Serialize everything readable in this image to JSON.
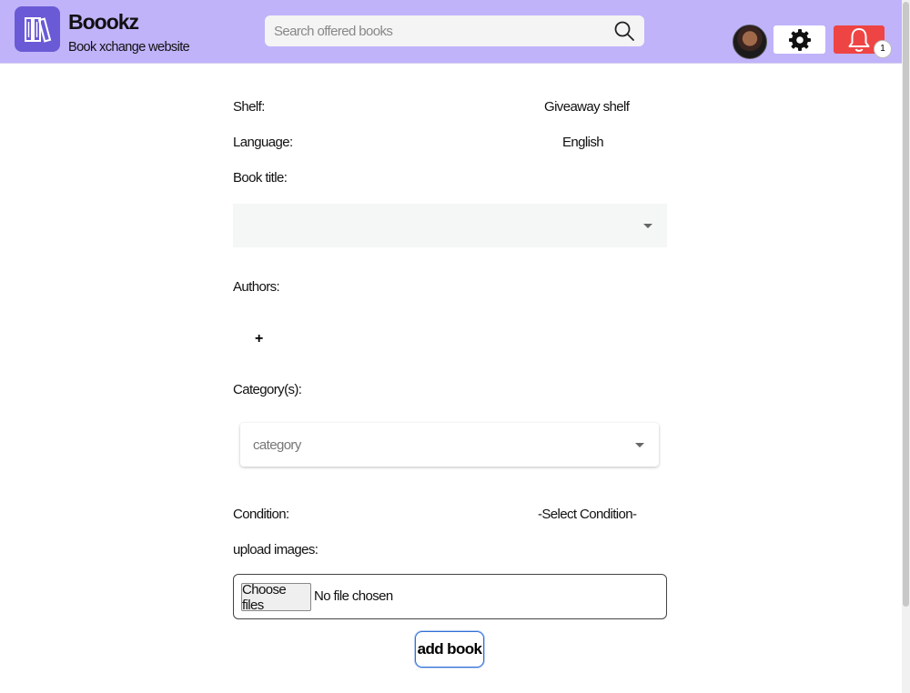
{
  "header": {
    "brand_title": "Boookz",
    "brand_subtitle": "Book xchange website",
    "search_placeholder": "Search offered books",
    "notification_count": "1",
    "icons": {
      "logo": "books-icon",
      "search": "search-icon",
      "settings": "gear-icon",
      "notifications": "bell-icon"
    }
  },
  "form": {
    "shelf_label": "Shelf:",
    "shelf_value": "Giveaway shelf",
    "language_label": "Language:",
    "language_value": "English",
    "book_title_label": "Book title:",
    "book_title_value": "",
    "authors_label": "Authors:",
    "add_author_symbol": "+",
    "categories_label": "Category(s):",
    "category_placeholder": "category",
    "condition_label": "Condition:",
    "condition_value": "-Select Condition-",
    "upload_label": "upload images:",
    "choose_files_label": "Choose files",
    "no_file_text": "No file chosen",
    "submit_label": "add book"
  }
}
